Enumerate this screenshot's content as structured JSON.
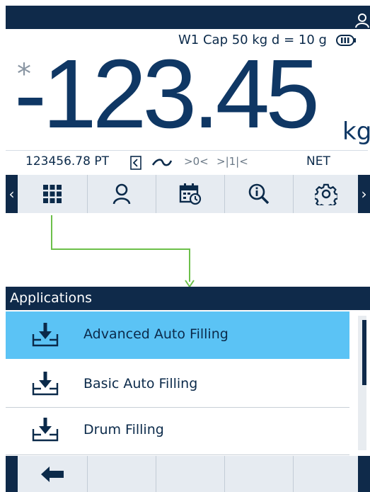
{
  "scale": {
    "capacity_text": "W1 Cap 50 kg d = 10 g",
    "motion_asterisk": "*",
    "weight_value": "-123.45",
    "unit": "kg",
    "secondary_value": "123456.78 PT",
    "center_zero": ">0<",
    "range_indicator": ">|1|<",
    "net_label": "NET"
  },
  "softkeys": [
    "applications-icon",
    "user-icon",
    "calendar-icon",
    "info-icon",
    "settings-icon"
  ],
  "applications": {
    "title": "Applications",
    "items": [
      {
        "label": "Advanced Auto Filling",
        "selected": true
      },
      {
        "label": "Basic Auto Filling",
        "selected": false
      },
      {
        "label": "Drum Filling",
        "selected": false
      }
    ]
  },
  "colors": {
    "header_bg": "#0f2a4a",
    "selection": "#5bc3f5",
    "connector": "#6cc04a",
    "softkey_bg": "#e6ebf1"
  }
}
